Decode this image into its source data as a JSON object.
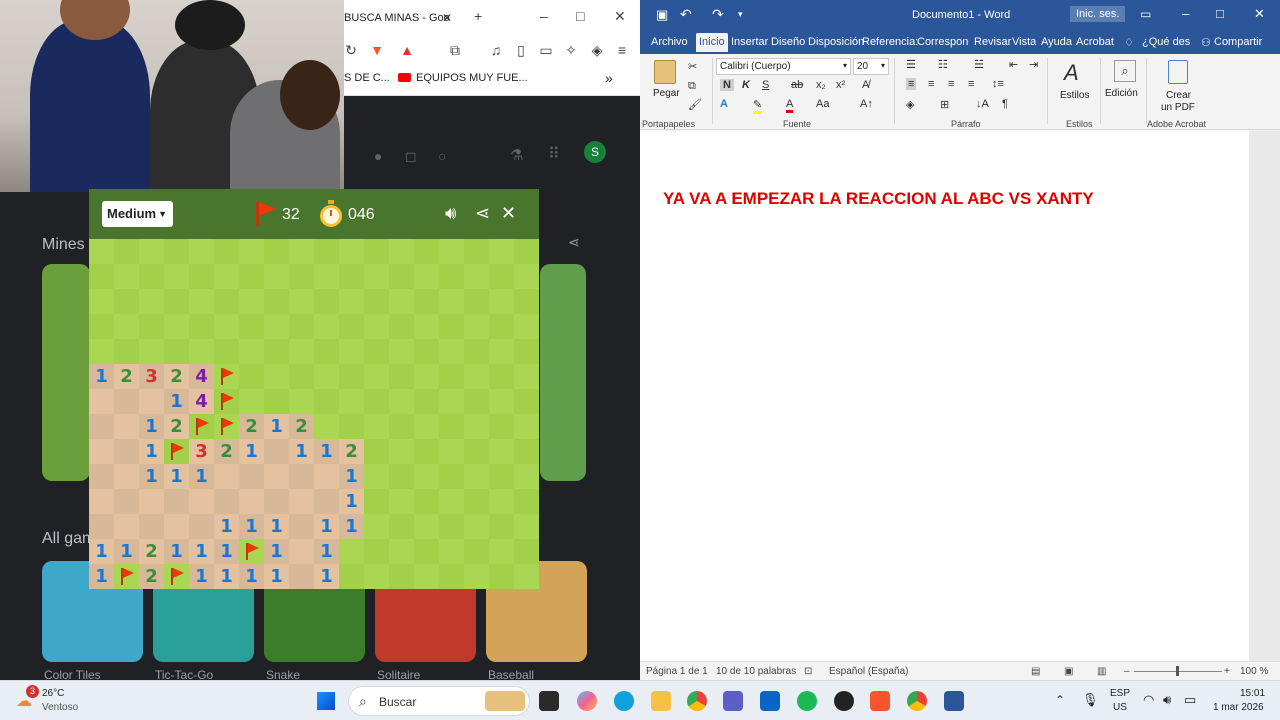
{
  "browser": {
    "tab_title": "BUSCA MINAS - Goo",
    "bookmarks": [
      "S DE C...",
      "EQUIPOS MUY FUE..."
    ],
    "overflow": "»"
  },
  "background": {
    "section1": "Mines",
    "section2": "All gam",
    "tiles": [
      "Color Tiles",
      "Tic-Tac-Go",
      "Snake",
      "Solitaire",
      "Baseball"
    ]
  },
  "minesweeper": {
    "level": "Medium",
    "flags": "32",
    "timer": "046",
    "rows": [
      "..........................",
      "..........................",
      "..........................",
      "..........................",
      "..........................",
      ".........................."
    ],
    "revealed": [
      [
        5,
        0,
        "1"
      ],
      [
        5,
        1,
        "2"
      ],
      [
        5,
        2,
        "3"
      ],
      [
        5,
        3,
        "2"
      ],
      [
        5,
        4,
        "4"
      ],
      [
        5,
        5,
        "F"
      ],
      [
        6,
        0,
        ""
      ],
      [
        6,
        1,
        ""
      ],
      [
        6,
        2,
        ""
      ],
      [
        6,
        3,
        "1"
      ],
      [
        6,
        4,
        "4"
      ],
      [
        6,
        5,
        "F"
      ],
      [
        7,
        0,
        ""
      ],
      [
        7,
        1,
        ""
      ],
      [
        7,
        2,
        "1"
      ],
      [
        7,
        3,
        "2"
      ],
      [
        7,
        4,
        "F"
      ],
      [
        7,
        5,
        "F"
      ],
      [
        7,
        6,
        "2"
      ],
      [
        7,
        7,
        "1"
      ],
      [
        7,
        8,
        "2"
      ],
      [
        8,
        0,
        ""
      ],
      [
        8,
        1,
        ""
      ],
      [
        8,
        2,
        "1"
      ],
      [
        8,
        3,
        "F"
      ],
      [
        8,
        4,
        "3"
      ],
      [
        8,
        5,
        "2"
      ],
      [
        8,
        6,
        "1"
      ],
      [
        8,
        7,
        ""
      ],
      [
        8,
        8,
        "1"
      ],
      [
        8,
        9,
        "1"
      ],
      [
        8,
        10,
        "2"
      ],
      [
        9,
        0,
        ""
      ],
      [
        9,
        1,
        ""
      ],
      [
        9,
        2,
        "1"
      ],
      [
        9,
        3,
        "1"
      ],
      [
        9,
        4,
        "1"
      ],
      [
        9,
        5,
        ""
      ],
      [
        9,
        6,
        ""
      ],
      [
        9,
        7,
        ""
      ],
      [
        9,
        8,
        ""
      ],
      [
        9,
        9,
        ""
      ],
      [
        9,
        10,
        "1"
      ],
      [
        10,
        0,
        ""
      ],
      [
        10,
        1,
        ""
      ],
      [
        10,
        2,
        ""
      ],
      [
        10,
        3,
        ""
      ],
      [
        10,
        4,
        ""
      ],
      [
        10,
        5,
        ""
      ],
      [
        10,
        6,
        ""
      ],
      [
        10,
        7,
        ""
      ],
      [
        10,
        8,
        ""
      ],
      [
        10,
        9,
        ""
      ],
      [
        10,
        10,
        "1"
      ],
      [
        11,
        0,
        ""
      ],
      [
        11,
        1,
        ""
      ],
      [
        11,
        2,
        ""
      ],
      [
        11,
        3,
        ""
      ],
      [
        11,
        4,
        ""
      ],
      [
        11,
        5,
        "1"
      ],
      [
        11,
        6,
        "1"
      ],
      [
        11,
        7,
        "1"
      ],
      [
        11,
        8,
        ""
      ],
      [
        11,
        9,
        "1"
      ],
      [
        11,
        10,
        "1"
      ],
      [
        12,
        0,
        "1"
      ],
      [
        12,
        1,
        "1"
      ],
      [
        12,
        2,
        "2"
      ],
      [
        12,
        3,
        "1"
      ],
      [
        12,
        4,
        "1"
      ],
      [
        12,
        5,
        "1"
      ],
      [
        12,
        6,
        "F"
      ],
      [
        12,
        7,
        "1"
      ],
      [
        12,
        8,
        ""
      ],
      [
        12,
        9,
        "1"
      ],
      [
        13,
        0,
        "1"
      ],
      [
        13,
        1,
        "F"
      ],
      [
        13,
        2,
        "2"
      ],
      [
        13,
        3,
        "F"
      ],
      [
        13,
        4,
        "1"
      ],
      [
        13,
        5,
        "1"
      ],
      [
        13,
        6,
        "1"
      ],
      [
        13,
        7,
        "1"
      ],
      [
        13,
        8,
        ""
      ],
      [
        13,
        9,
        "1"
      ]
    ],
    "num_colors": {
      "1": "#1976d2",
      "2": "#388e3c",
      "3": "#d32f2f",
      "4": "#7b1fa2"
    },
    "flag_color": "#f23607"
  },
  "word": {
    "qat_title": "Documento1 - Word",
    "signin": "Inic. ses.",
    "tabs": [
      "Archivo",
      "Inicio",
      "Insertar",
      "Diseño",
      "Disposición",
      "Referencias",
      "Correspondencia",
      "Revisar",
      "Vista",
      "Ayuda",
      "Acrobat",
      "¿Qué des",
      "Compartir"
    ],
    "tab_display": [
      "Archivo",
      "Inicio",
      "Insertar",
      "Diseño",
      "Disposición",
      "Referencia:",
      "Correspond",
      "Revisar",
      "Vista",
      "Ayuda",
      "Acrobat"
    ],
    "tell_me": "¿Qué des",
    "share": "Compartir",
    "paste": "Pegar",
    "font_name": "Calibri (Cuerpo)",
    "font_size": "20",
    "groups": [
      "Portapapeles",
      "Fuente",
      "Párrafo",
      "Estilos",
      "Adobe Acrobat"
    ],
    "styles_btn": "Estilos",
    "edit_btn": "Edición",
    "pdf_btn_1": "Crear",
    "pdf_btn_2": "un PDF",
    "doc_text": "YA VA A EMPEZAR LA REACCION AL ABC VS XANTY",
    "status_page": "Página 1 de 1",
    "status_words": "10 de 10 palabras",
    "status_lang": "Español (España)",
    "zoom": "100 %",
    "accent": "#2b579a"
  },
  "taskbar": {
    "weather_temp": "26°C",
    "weather_desc": "Ventoso",
    "weather_badge": "3",
    "search": "Buscar",
    "lang1": "ESP",
    "lang2": "US",
    "time": "15:01",
    "date": "1 mar 2026"
  }
}
